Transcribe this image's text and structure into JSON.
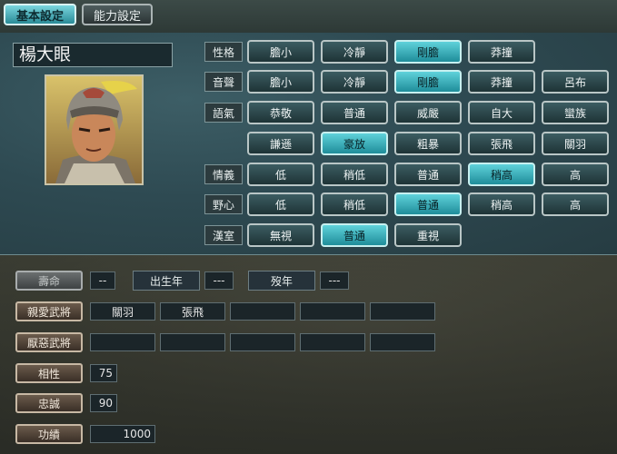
{
  "tabs": [
    {
      "label": "基本設定",
      "active": true
    },
    {
      "label": "能力設定",
      "active": false
    }
  ],
  "officer": {
    "name": "楊大眼"
  },
  "personality": {
    "rows": [
      {
        "label": "性格",
        "options": [
          "膽小",
          "冷靜",
          "剛膽",
          "莽撞"
        ],
        "selected": 2
      },
      {
        "label": "音聲",
        "options": [
          "膽小",
          "冷靜",
          "剛膽",
          "莽撞",
          "呂布"
        ],
        "selected": 2
      },
      {
        "label": "語氣",
        "options": [
          "恭敬",
          "普通",
          "威嚴",
          "自大",
          "蠻族"
        ],
        "selected": -1
      },
      {
        "label": "",
        "options": [
          "謙遜",
          "豪放",
          "粗暴",
          "張飛",
          "關羽"
        ],
        "selected": 1
      },
      {
        "label": "情義",
        "options": [
          "低",
          "稍低",
          "普通",
          "稍高",
          "高"
        ],
        "selected": 3
      },
      {
        "label": "野心",
        "options": [
          "低",
          "稍低",
          "普通",
          "稍高",
          "高"
        ],
        "selected": 2
      },
      {
        "label": "漢室",
        "options": [
          "無視",
          "普通",
          "重視"
        ],
        "selected": 1
      }
    ]
  },
  "details": {
    "lifespan_label": "壽命",
    "lifespan_value": "--",
    "birth_label": "出生年",
    "birth_value": "---",
    "death_label": "歿年",
    "death_value": "---",
    "liked_label": "親愛武將",
    "liked": [
      "關羽",
      "張飛",
      "",
      "",
      ""
    ],
    "disliked_label": "厭惡武將",
    "disliked": [
      "",
      "",
      "",
      "",
      ""
    ],
    "compat_label": "相性",
    "compat_value": "75",
    "loyalty_label": "忠誠",
    "loyalty_value": "90",
    "merit_label": "功績",
    "merit_value": "1000"
  }
}
